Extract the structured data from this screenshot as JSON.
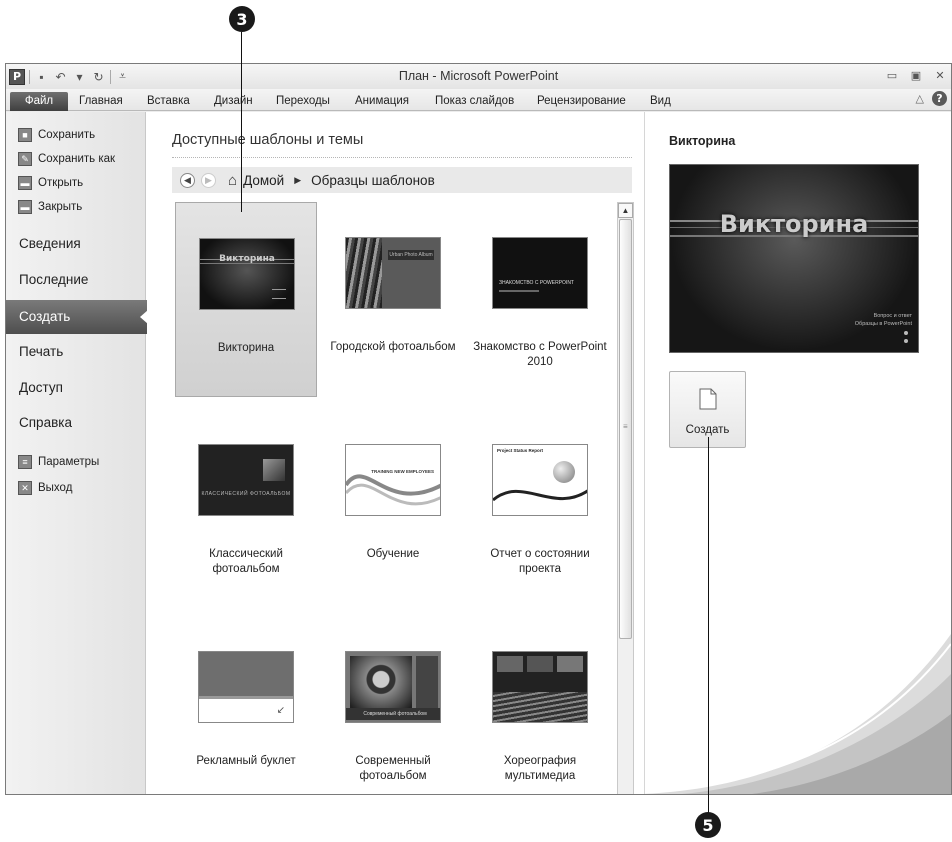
{
  "callouts": {
    "top": "3",
    "bottom": "5"
  },
  "window": {
    "title": "План  -  Microsoft PowerPoint",
    "app_icon": "P"
  },
  "quick_access": [
    {
      "icon": "save-icon",
      "glyph": "▪"
    },
    {
      "icon": "undo-icon",
      "glyph": "↶"
    },
    {
      "icon": "undo-dropdown-icon",
      "glyph": "▾"
    },
    {
      "icon": "redo-icon",
      "glyph": "↻"
    },
    {
      "icon": "customize-qat-icon",
      "glyph": "⩡"
    }
  ],
  "window_controls": {
    "minimize": "▭",
    "restore": "▣",
    "close": "✕"
  },
  "ribbon": {
    "file_tab": "Файл",
    "tabs": [
      "Главная",
      "Вставка",
      "Дизайн",
      "Переходы",
      "Анимация",
      "Показ слайдов",
      "Рецензирование",
      "Вид"
    ],
    "collapse_icon": "△",
    "help_icon": "?"
  },
  "backstage_nav": {
    "commands": [
      {
        "label": "Сохранить",
        "icon": "save-icon",
        "glyph": "■"
      },
      {
        "label": "Сохранить как",
        "icon": "save-as-icon",
        "glyph": "✎"
      },
      {
        "label": "Открыть",
        "icon": "open-folder-icon",
        "glyph": "▬"
      },
      {
        "label": "Закрыть",
        "icon": "close-folder-icon",
        "glyph": "▬"
      }
    ],
    "tabs": [
      {
        "label": "Сведения",
        "active": false
      },
      {
        "label": "Последние",
        "active": false
      },
      {
        "label": "Создать",
        "active": true
      },
      {
        "label": "Печать",
        "active": false
      },
      {
        "label": "Доступ",
        "active": false
      },
      {
        "label": "Справка",
        "active": false
      }
    ],
    "bottom_commands": [
      {
        "label": "Параметры",
        "icon": "options-icon",
        "glyph": "≡"
      },
      {
        "label": "Выход",
        "icon": "exit-icon",
        "glyph": "✕"
      }
    ]
  },
  "templates_panel": {
    "heading": "Доступные шаблоны и темы",
    "breadcrumb": {
      "home": "Домой",
      "current": "Образцы шаблонов"
    },
    "templates": [
      {
        "label": "Викторина",
        "selected": true,
        "thumb_text": "Викторина"
      },
      {
        "label": "Городской фотоальбом",
        "selected": false,
        "thumb_text": "Urban Photo Album"
      },
      {
        "label": "Знакомство с PowerPoint 2010",
        "selected": false,
        "thumb_text": "ЗНАКОМСТВО С POWERPOINT"
      },
      {
        "label": "Классический фотоальбом",
        "selected": false,
        "thumb_text": "КЛАССИЧЕСКИЙ ФОТОАЛЬБОМ"
      },
      {
        "label": "Обучение",
        "selected": false,
        "thumb_text": "TRAINING NEW EMPLOYEES"
      },
      {
        "label": "Отчет о состоянии проекта",
        "selected": false,
        "thumb_text": "Project Status Report"
      },
      {
        "label": "Рекламный буклет",
        "selected": false,
        "thumb_text": ""
      },
      {
        "label": "Современный фотоальбом",
        "selected": false,
        "thumb_text": "Современный фотоальбом"
      },
      {
        "label": "Хореография мультимедиа",
        "selected": false,
        "thumb_text": ""
      }
    ]
  },
  "preview": {
    "title": "Викторина",
    "slide_title": "Викторина",
    "slide_subtitle_1": "Вопрос и ответ",
    "slide_subtitle_2": "Образцы в PowerPoint",
    "create_label": "Создать"
  }
}
